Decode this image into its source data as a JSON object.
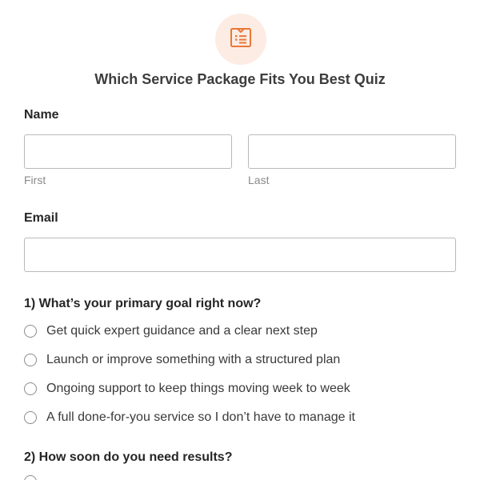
{
  "form": {
    "title": "Which Service Package Fits You Best Quiz",
    "logo_icon": "clipboard-list-icon",
    "accent_color": "#e8783a",
    "logo_bg_color": "#fdece3"
  },
  "name_field": {
    "label": "Name",
    "first_sublabel": "First",
    "last_sublabel": "Last",
    "first_value": "",
    "last_value": ""
  },
  "email_field": {
    "label": "Email",
    "value": ""
  },
  "questions": [
    {
      "label": "1) What’s your primary goal right now?",
      "options": [
        "Get quick expert guidance and a clear next step",
        "Launch or improve something with a structured plan",
        "Ongoing support to keep things moving week to week",
        "A full done-for-you service so I don’t have to manage it"
      ]
    },
    {
      "label": "2) How soon do you need results?"
    }
  ]
}
